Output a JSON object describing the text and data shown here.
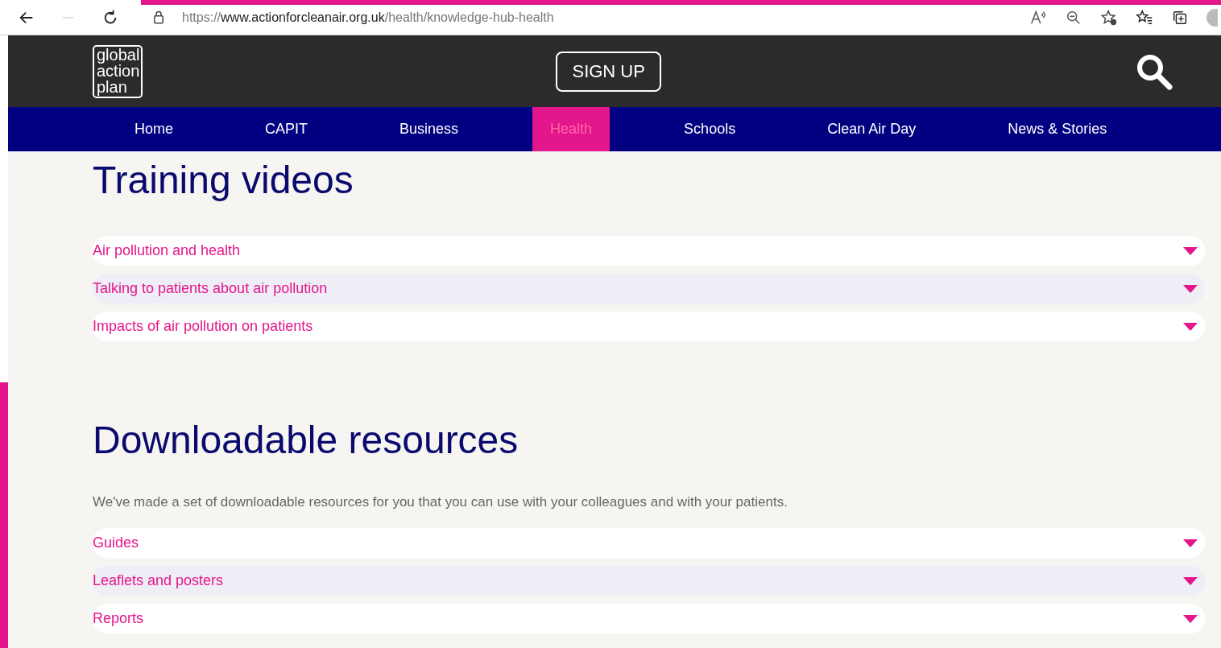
{
  "browser": {
    "url_prefix": "https://",
    "url_domain": "www.actionforcleanair.org.uk",
    "url_path": "/health/knowledge-hub-health"
  },
  "header": {
    "logo_lines": [
      "global",
      "action",
      "plan"
    ],
    "signup": "SIGN UP"
  },
  "nav": [
    {
      "label": "Home",
      "selected": false
    },
    {
      "label": "CAPIT",
      "selected": false
    },
    {
      "label": "Business",
      "selected": false
    },
    {
      "label": "Health",
      "selected": true
    },
    {
      "label": "Schools",
      "selected": false
    },
    {
      "label": "Clean Air Day",
      "selected": false
    },
    {
      "label": "News & Stories",
      "selected": false
    }
  ],
  "sections": [
    {
      "title": "Training videos",
      "items": [
        {
          "label": "Air pollution and health",
          "expanded": false
        },
        {
          "label": "Talking to patients about air pollution",
          "expanded": false
        },
        {
          "label": "Impacts of air pollution on patients",
          "expanded": false
        }
      ]
    },
    {
      "title": "Downloadable resources",
      "intro": "We've made a set of downloadable resources for you that you can use with your colleagues and with your patients.",
      "items": [
        {
          "label": "Guides",
          "expanded": false
        },
        {
          "label": "Leaflets and posters",
          "expanded": false
        },
        {
          "label": "Reports",
          "expanded": false
        }
      ]
    }
  ]
}
